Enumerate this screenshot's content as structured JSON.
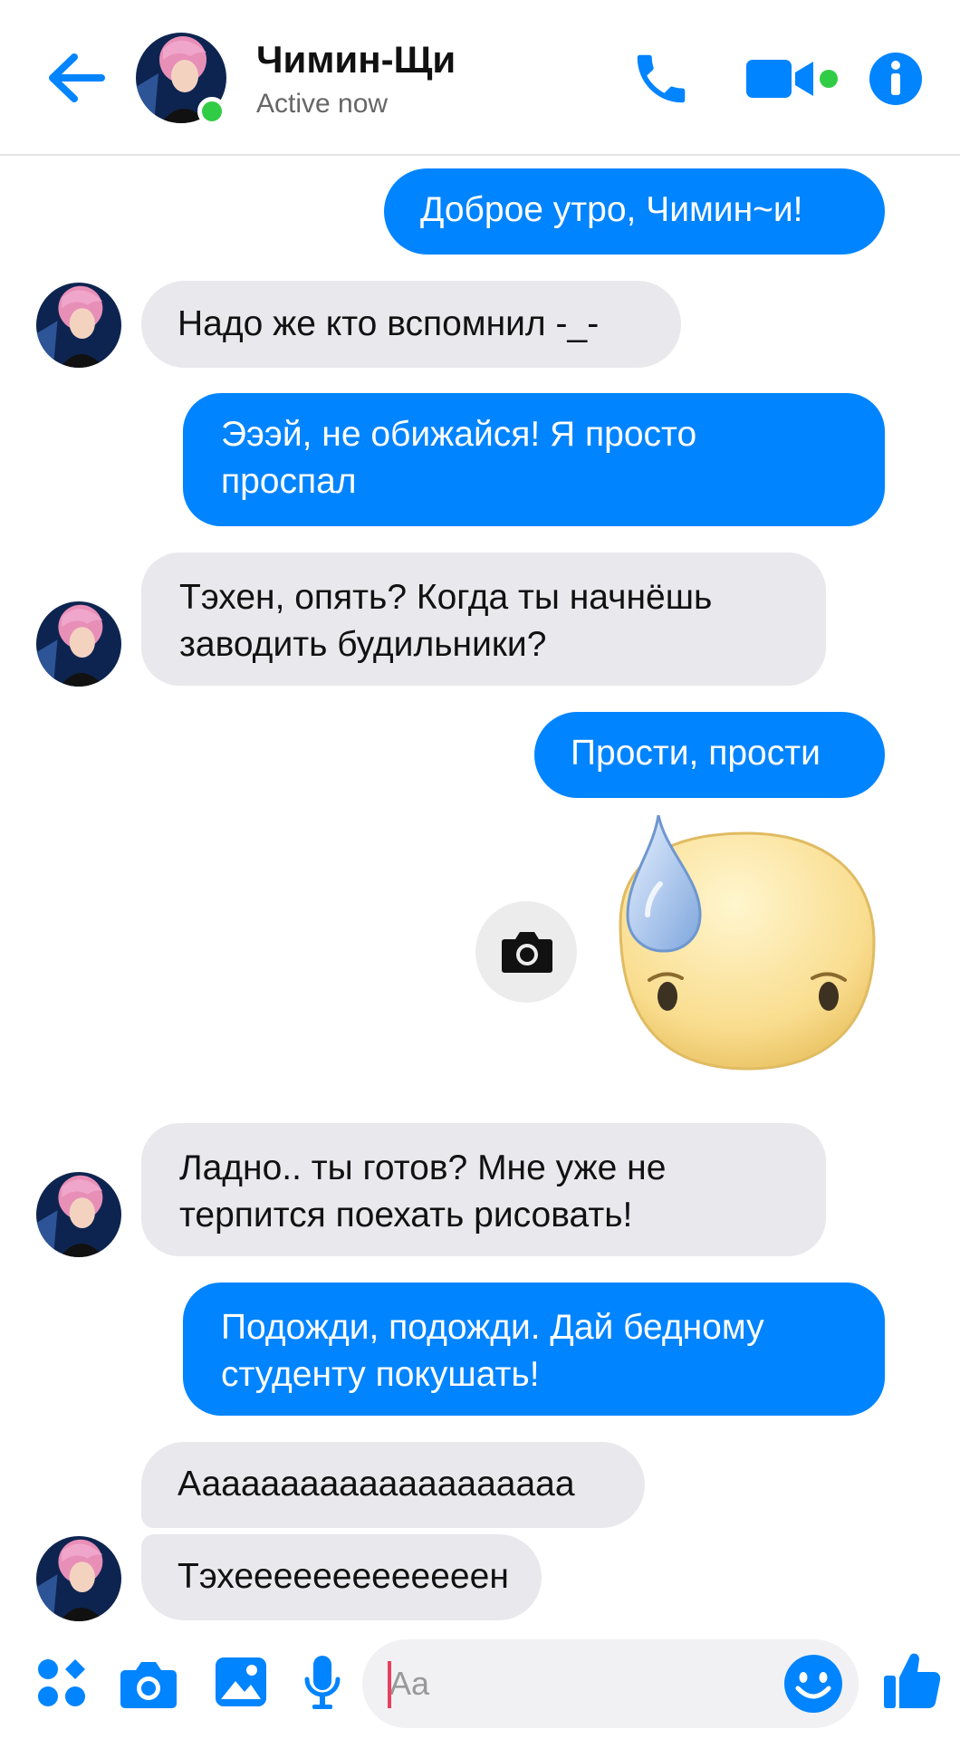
{
  "header": {
    "contact_name": "Чимин-Щи",
    "status": "Active now",
    "icons": {
      "back": "arrow-left-icon",
      "call": "phone-icon",
      "video": "video-camera-icon",
      "info": "info-icon"
    }
  },
  "colors": {
    "accent": "#0084ff",
    "incoming_bubble": "#e9e8ed",
    "online": "#31cc46"
  },
  "messages": [
    {
      "direction": "out",
      "text": "Доброе утро, Чимин~и!"
    },
    {
      "direction": "in",
      "text": "Надо же кто вспомнил -_-"
    },
    {
      "direction": "out",
      "lines": [
        "Эээй, не обижайся! Я просто",
        "проспал"
      ]
    },
    {
      "direction": "in",
      "lines": [
        "Тэхен, опять? Когда ты начнёшь",
        "заводить будильники?"
      ]
    },
    {
      "direction": "out",
      "text": "Прости, прости"
    },
    {
      "direction": "out",
      "type": "sticker",
      "sticker": "sweat-drop-face-sticker"
    },
    {
      "direction": "in",
      "lines": [
        "Ладно.. ты готов? Мне уже не",
        "терпится поехать рисовать!"
      ]
    },
    {
      "direction": "out",
      "lines": [
        "Подожди, подожди. Дай бедному",
        "студенту покушать!"
      ]
    },
    {
      "direction": "in",
      "text": "Аааааааааааааааааааа"
    },
    {
      "direction": "in",
      "text": "Тэхееееееееееееен"
    }
  ],
  "composer": {
    "placeholder": "Aa",
    "icons": [
      "apps-grid-icon",
      "camera-icon",
      "image-icon",
      "microphone-icon",
      "smiley-icon",
      "thumbs-up-icon"
    ]
  }
}
